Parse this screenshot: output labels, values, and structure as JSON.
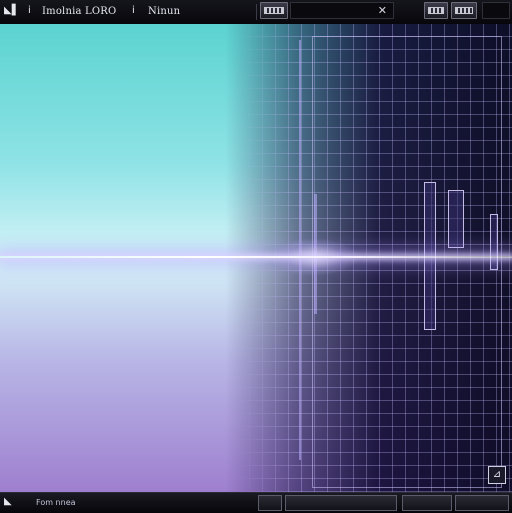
{
  "toolbar": {
    "app_icon": "app-icon",
    "tool_a": "i",
    "title": "Imolnia LORO",
    "tool_b": "i",
    "mode_label": "Ninun",
    "close_glyph": "✕",
    "buttons": [
      "slider-button",
      "image-button-1",
      "image-button-2"
    ]
  },
  "canvas": {
    "corner_glyph": "⊿"
  },
  "statusbar": {
    "app_icon": "app-icon",
    "text": "Fom nnea"
  },
  "colors": {
    "accent": "#8f7fe8",
    "canvas_top": "#5bd3d0",
    "canvas_bottom": "#9e7fcf",
    "grid_bg": "#120c34"
  }
}
